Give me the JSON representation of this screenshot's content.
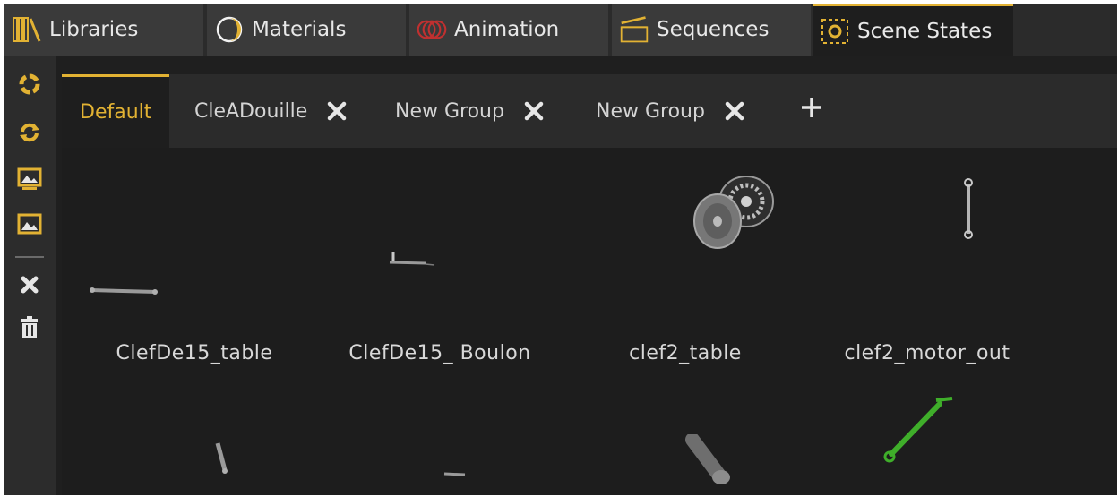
{
  "top_tabs": [
    {
      "label": "Libraries",
      "icon": "books-icon",
      "active": false
    },
    {
      "label": "Materials",
      "icon": "material-icon",
      "active": false
    },
    {
      "label": "Animation",
      "icon": "animation-icon",
      "active": false
    },
    {
      "label": "Sequences",
      "icon": "clapperboard-icon",
      "active": false
    },
    {
      "label": "Scene States",
      "icon": "scene-state-icon",
      "active": true
    }
  ],
  "sidebar": {
    "buttons": [
      "refresh-icon",
      "update-icon",
      "capture-image-icon",
      "image-icon",
      "close-icon",
      "trash-icon"
    ]
  },
  "group_tabs": [
    {
      "label": "Default",
      "active": true,
      "closable": false
    },
    {
      "label": "CleADouille",
      "active": false,
      "closable": true
    },
    {
      "label": "New Group",
      "active": false,
      "closable": true
    },
    {
      "label": "New Group",
      "active": false,
      "closable": true
    }
  ],
  "scene_states": [
    {
      "name": "ClefDe15_table"
    },
    {
      "name": "ClefDe15_ Boulon"
    },
    {
      "name": "clef2_table"
    },
    {
      "name": "clef2_motor_out"
    },
    {
      "name": ""
    },
    {
      "name": ""
    },
    {
      "name": ""
    },
    {
      "name": ""
    }
  ],
  "colors": {
    "accent": "#e2b233",
    "background": "#1d1d1d",
    "panel": "#2b2b2b",
    "highlight_part": "#3fae2a"
  }
}
